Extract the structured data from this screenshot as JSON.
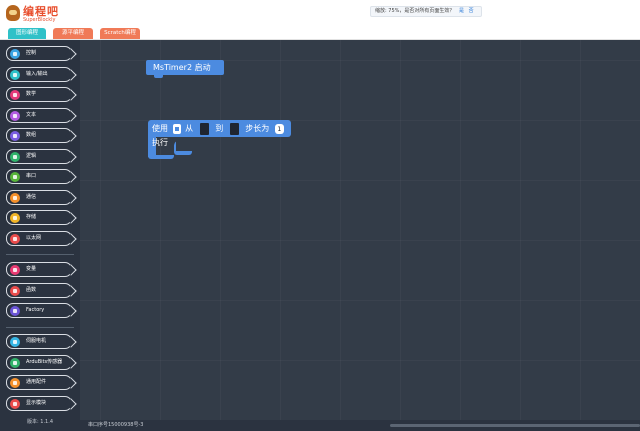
{
  "header": {
    "logo_text": "编程吧",
    "logo_sub": "SuperBlockly",
    "tabs": [
      {
        "label": "图形编程",
        "color": "#2fc1c8"
      },
      {
        "label": "源平编程",
        "color": "#f07a57"
      },
      {
        "label": "Scratch编程",
        "color": "#f07a57"
      }
    ],
    "zoom_notice": "缩放: 75%，是否对所有页面生效？",
    "zoom_yes": "是",
    "zoom_no": "否"
  },
  "sidebar": {
    "groups": [
      [
        {
          "label": "控制",
          "icon": "control-icon",
          "color": "#3ba3e4"
        },
        {
          "label": "输入/输出",
          "icon": "io-icon",
          "color": "#2ec1c9"
        },
        {
          "label": "数学",
          "icon": "math-icon",
          "color": "#e63a79"
        },
        {
          "label": "文本",
          "icon": "text-icon",
          "color": "#b35ce0"
        },
        {
          "label": "数组",
          "icon": "array-icon",
          "color": "#7a5de0"
        },
        {
          "label": "逻辑",
          "icon": "logic-icon",
          "color": "#30b36b"
        },
        {
          "label": "串口",
          "icon": "serial-icon",
          "color": "#58b43a"
        },
        {
          "label": "通信",
          "icon": "comm-icon",
          "color": "#f4912c"
        },
        {
          "label": "存储",
          "icon": "storage-icon",
          "color": "#f1b528"
        },
        {
          "label": "以太网",
          "icon": "ethernet-icon",
          "color": "#e94c4c"
        }
      ],
      [
        {
          "label": "变量",
          "icon": "variable-icon",
          "color": "#e83a72"
        },
        {
          "label": "函数",
          "icon": "function-icon",
          "color": "#e94c4c"
        },
        {
          "label": "Factory",
          "icon": "factory-icon",
          "color": "#6b55d6"
        }
      ],
      [
        {
          "label": "伺服电机",
          "icon": "servo-icon",
          "color": "#37b7e6"
        },
        {
          "label": "ArduBits传感器",
          "icon": "sensor-icon",
          "color": "#32b36a"
        },
        {
          "label": "通用配件",
          "icon": "accessory-icon",
          "color": "#f4912c"
        },
        {
          "label": "显示模块",
          "icon": "display-icon",
          "color": "#e94c4c"
        }
      ]
    ],
    "version": "版本: 1.1.4"
  },
  "workspace": {
    "timer_block": "MsTimer2 启动",
    "loop_block": {
      "prefix": "使用",
      "from": "从",
      "to": "到",
      "step": "步长为",
      "step_value": "1",
      "exec": "执行"
    }
  },
  "statusbar": {
    "serial": "串口序号15000938号-3"
  }
}
